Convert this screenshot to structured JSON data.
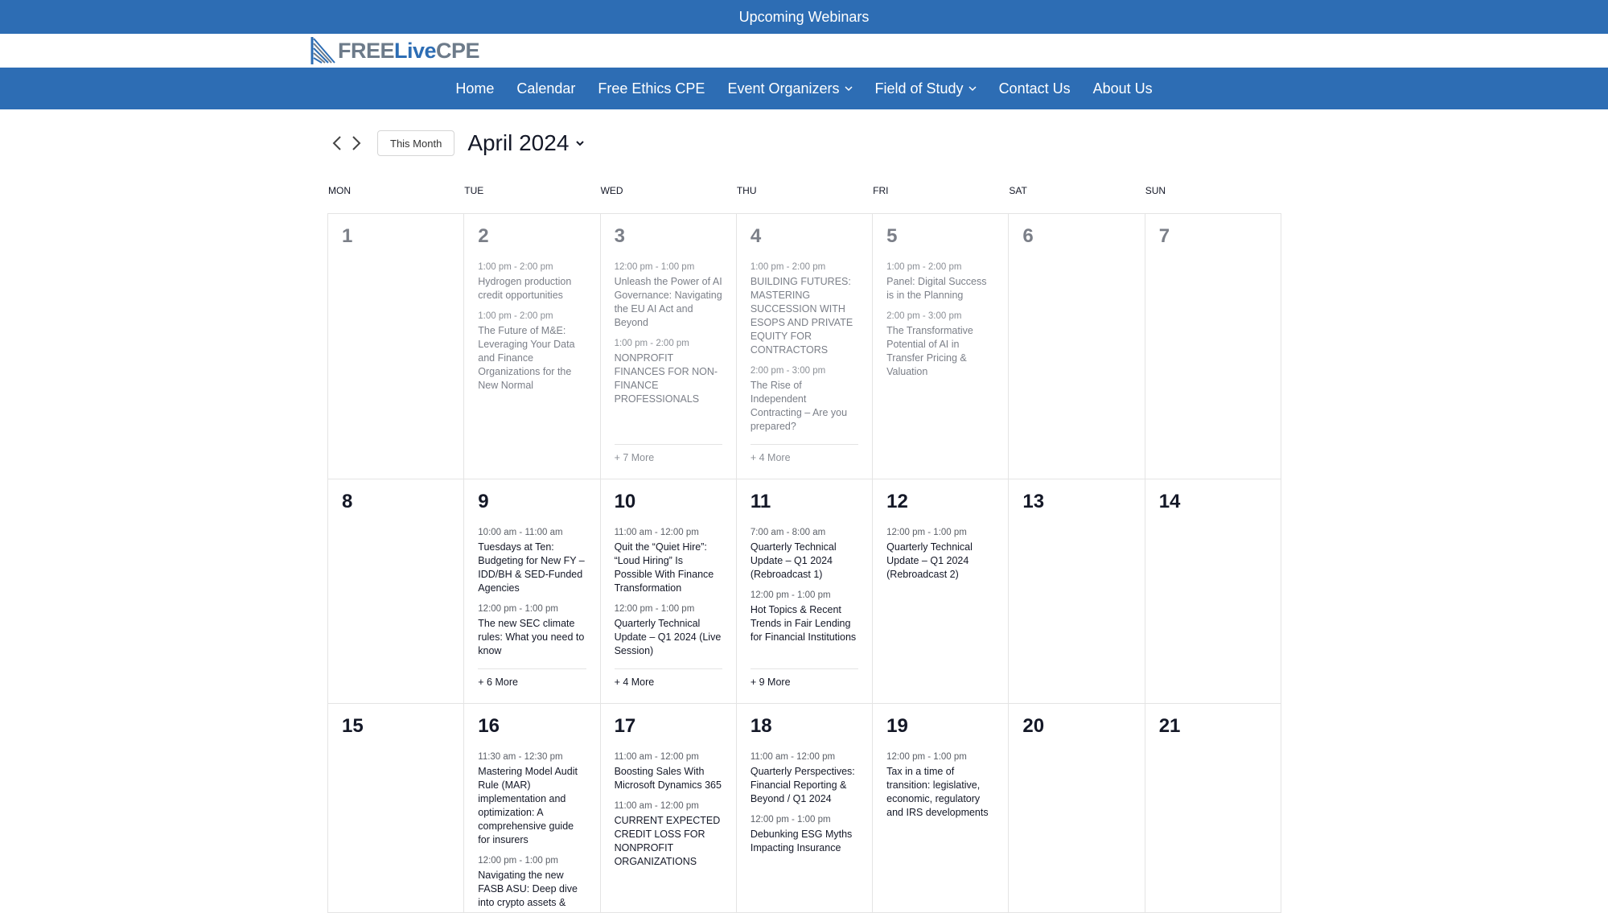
{
  "topbar": {
    "label": "Upcoming Webinars"
  },
  "logo": {
    "part1": "FREE",
    "part2": "Live",
    "part3": "CPE"
  },
  "nav": {
    "home": "Home",
    "calendar": "Calendar",
    "ethics": "Free Ethics CPE",
    "organizers": "Event Organizers",
    "field": "Field of Study",
    "contact": "Contact Us",
    "about": "About Us"
  },
  "toolbar": {
    "this_month": "This Month",
    "month": "April 2024"
  },
  "weekdays": [
    "MON",
    "TUE",
    "WED",
    "THU",
    "FRI",
    "SAT",
    "SUN"
  ],
  "days": {
    "d1": {
      "num": "1"
    },
    "d2": {
      "num": "2",
      "events": [
        {
          "time": "1:00 pm - 2:00 pm",
          "title": "Hydrogen production credit opportunities"
        },
        {
          "time": "1:00 pm - 2:00 pm",
          "title": "The Future of M&E: Leveraging Your Data and Finance Organizations for the New Normal"
        }
      ]
    },
    "d3": {
      "num": "3",
      "events": [
        {
          "time": "12:00 pm - 1:00 pm",
          "title": "Unleash the Power of AI Governance: Navigating the EU AI Act and Beyond"
        },
        {
          "time": "1:00 pm - 2:00 pm",
          "title": "NONPROFIT FINANCES FOR NON-FINANCE PROFESSIONALS"
        }
      ],
      "more": "+ 7 More"
    },
    "d4": {
      "num": "4",
      "events": [
        {
          "time": "1:00 pm - 2:00 pm",
          "title": "BUILDING FUTURES: MASTERING SUCCESSION WITH ESOPS AND PRIVATE EQUITY FOR CONTRACTORS"
        },
        {
          "time": "2:00 pm - 3:00 pm",
          "title": "The Rise of Independent Contracting – Are you prepared?"
        }
      ],
      "more": "+ 4 More"
    },
    "d5": {
      "num": "5",
      "events": [
        {
          "time": "1:00 pm - 2:00 pm",
          "title": "Panel: Digital Success is in the Planning"
        },
        {
          "time": "2:00 pm - 3:00 pm",
          "title": "The Transformative Potential of AI in Transfer Pricing & Valuation"
        }
      ]
    },
    "d6": {
      "num": "6"
    },
    "d7": {
      "num": "7"
    },
    "d8": {
      "num": "8"
    },
    "d9": {
      "num": "9",
      "events": [
        {
          "time": "10:00 am - 11:00 am",
          "title": "Tuesdays at Ten: Budgeting for New FY – IDD/BH & SED-Funded Agencies"
        },
        {
          "time": "12:00 pm - 1:00 pm",
          "title": "The new SEC climate rules: What you need to know"
        }
      ],
      "more": "+ 6 More"
    },
    "d10": {
      "num": "10",
      "events": [
        {
          "time": "11:00 am - 12:00 pm",
          "title": "Quit the “Quiet Hire”: “Loud Hiring” Is Possible With Finance Transformation"
        },
        {
          "time": "12:00 pm - 1:00 pm",
          "title": "Quarterly Technical Update – Q1 2024 (Live Session)"
        }
      ],
      "more": "+ 4 More"
    },
    "d11": {
      "num": "11",
      "events": [
        {
          "time": "7:00 am - 8:00 am",
          "title": "Quarterly Technical Update – Q1 2024 (Rebroadcast 1)"
        },
        {
          "time": "12:00 pm - 1:00 pm",
          "title": "Hot Topics & Recent Trends in Fair Lending for Financial Institutions"
        }
      ],
      "more": "+ 9 More"
    },
    "d12": {
      "num": "12",
      "events": [
        {
          "time": "12:00 pm - 1:00 pm",
          "title": "Quarterly Technical Update – Q1 2024 (Rebroadcast 2)"
        }
      ]
    },
    "d13": {
      "num": "13"
    },
    "d14": {
      "num": "14"
    },
    "d15": {
      "num": "15"
    },
    "d16": {
      "num": "16",
      "events": [
        {
          "time": "11:30 am - 12:30 pm",
          "title": "Mastering Model Audit Rule (MAR) implementation and optimization: A comprehensive guide for insurers"
        },
        {
          "time": "12:00 pm - 1:00 pm",
          "title": "Navigating the new FASB ASU: Deep dive into crypto assets &"
        }
      ]
    },
    "d17": {
      "num": "17",
      "events": [
        {
          "time": "11:00 am - 12:00 pm",
          "title": "Boosting Sales With Microsoft Dynamics 365"
        },
        {
          "time": "11:00 am - 12:00 pm",
          "title": "CURRENT EXPECTED CREDIT LOSS FOR NONPROFIT ORGANIZATIONS"
        }
      ]
    },
    "d18": {
      "num": "18",
      "events": [
        {
          "time": "11:00 am - 12:00 pm",
          "title": "Quarterly Perspectives: Financial Reporting & Beyond / Q1 2024"
        },
        {
          "time": "12:00 pm - 1:00 pm",
          "title": "Debunking ESG Myths Impacting Insurance"
        }
      ]
    },
    "d19": {
      "num": "19",
      "events": [
        {
          "time": "12:00 pm - 1:00 pm",
          "title": "Tax in a time of transition: legislative, economic, regulatory and IRS developments"
        }
      ]
    },
    "d20": {
      "num": "20"
    },
    "d21": {
      "num": "21"
    }
  },
  "colors": {
    "brand_blue": "#2d6db4",
    "logo_gray": "#6d7b8a"
  }
}
